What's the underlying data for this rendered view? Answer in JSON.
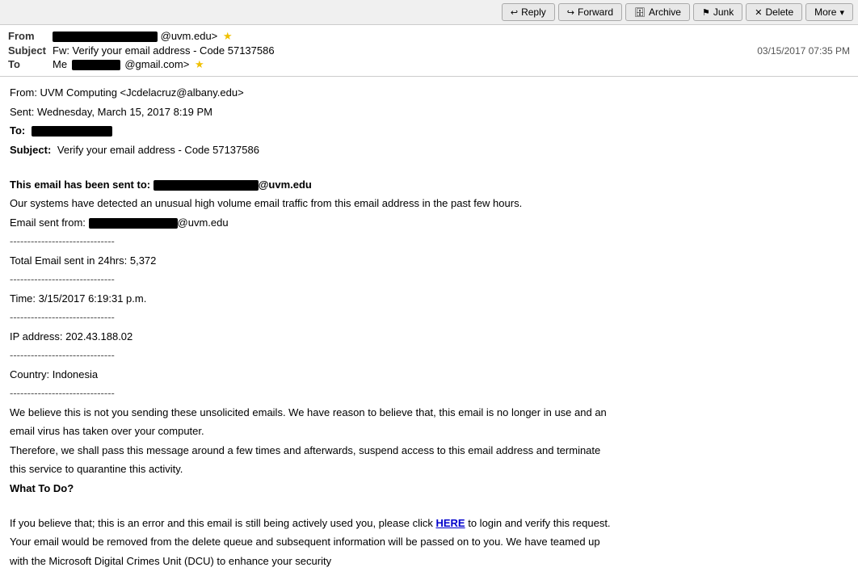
{
  "toolbar": {
    "reply_label": "Reply",
    "forward_label": "Forward",
    "archive_label": "Archive",
    "junk_label": "Junk",
    "delete_label": "Delete",
    "more_label": "More"
  },
  "header": {
    "from_label": "From",
    "from_redacted_width": 130,
    "from_redacted_height": 13,
    "from_domain": "@uvm.edu>",
    "subject_label": "Subject",
    "subject_text": "Fw: Verify your email address - Code 57137586",
    "date": "03/15/2017 07:35 PM",
    "to_label": "To",
    "to_prefix": "Me",
    "to_redacted_width": 60,
    "to_redacted_height": 13,
    "to_suffix": "@gmail.com>"
  },
  "body": {
    "from_line": "From: UVM Computing <Jcdelacruz@albany.edu>",
    "sent_line": "Sent: Wednesday, March 15, 2017 8:19 PM",
    "to_label": "To:",
    "to_redacted_width": 100,
    "subject_label": "Subject:",
    "subject_value": "Verify your email address - Code 57137586",
    "this_email_sent_to_prefix": "This email has been sent to: ",
    "this_email_redacted_width": 130,
    "this_email_suffix": "@uvm.edu",
    "unusual_traffic": "Our systems have detected an unusual high volume email traffic from this email address in the past few hours.",
    "email_sent_from_prefix": "Email sent from: ",
    "email_sent_from_redacted_width": 110,
    "email_sent_from_suffix": "@uvm.edu",
    "divider1": "------------------------------",
    "total_email": "Total Email sent in 24hrs: 5,372",
    "divider2": "------------------------------",
    "time_line": "Time: 3/15/2017 6:19:31 p.m.",
    "divider3": "------------------------------",
    "ip_line": "IP address: 202.43.188.02",
    "divider4": "------------------------------",
    "country_line": "Country: Indonesia",
    "divider5": "------------------------------",
    "believe_line1": "We believe this is not you sending these unsolicited emails. We have reason to believe that, this email is no longer in use and an",
    "believe_line2": "email virus has taken over your computer.",
    "therefore_line1": "Therefore, we shall pass this message around a few times and afterwards, suspend access to this email address and terminate",
    "therefore_line2": "this service to quarantine this activity.",
    "what_to_do": "What To Do?",
    "if_you_believe_prefix": "If you believe that; this is an error and this email is still being actively used you, please click ",
    "here_link": "HERE",
    "if_you_believe_suffix": " to login and verify this request.",
    "your_email_line": "Your email would be removed from the delete queue and subsequent information will be passed on to you. We have teamed up",
    "with_microsoft_line": "with the Microsoft Digital Crimes Unit (DCU) to enhance your security"
  }
}
